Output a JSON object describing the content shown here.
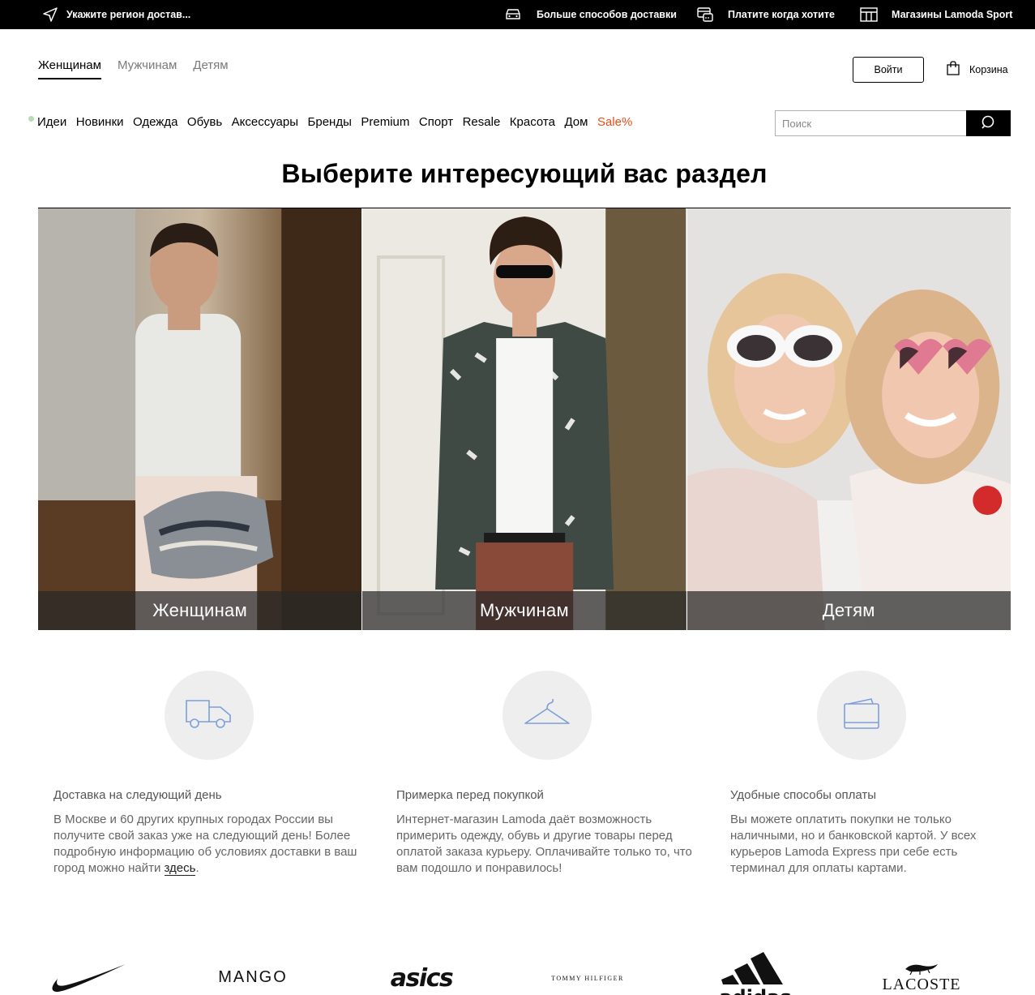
{
  "topbar": {
    "region": "Укажите регион достав...",
    "delivery": "Больше способов доставки",
    "pay": "Платите когда хотите",
    "stores": "Магазины Lamoda Sport"
  },
  "header": {
    "gender_tabs": [
      "Женщинам",
      "Мужчинам",
      "Детям"
    ],
    "active_tab": "Женщинам",
    "login": "Войти",
    "cart": "Корзина"
  },
  "catnav": {
    "items": [
      "Идеи",
      "Новинки",
      "Одежда",
      "Обувь",
      "Аксессуары",
      "Бренды",
      "Premium",
      "Спорт",
      "Resale",
      "Красота",
      "Дом"
    ],
    "sale": "Sale%"
  },
  "search": {
    "placeholder": "Поиск"
  },
  "main": {
    "title": "Выберите интересующий вас раздел",
    "sections": [
      {
        "label": "Женщинам"
      },
      {
        "label": "Мужчинам"
      },
      {
        "label": "Детям"
      }
    ]
  },
  "features": [
    {
      "icon": "delivery-truck-icon",
      "title": "Доставка на следующий день",
      "text": "В Москве и 60 других крупных городах России вы получите свой заказ уже на следующий день! Более подробную информацию об условиях доставки в ваш город можно найти ",
      "link": "здесь",
      "tail": "."
    },
    {
      "icon": "hanger-icon",
      "title": "Примерка перед покупкой",
      "text": "Интернет-магазин Lamoda даёт возможность примерить одежду, обувь и другие товары перед оплатой заказа курьеру. Оплачивайте только то, что вам подошло и понравилось!"
    },
    {
      "icon": "wallet-icon",
      "title": "Удобные способы оплаты",
      "text": "Вы можете оплатить покупки не только наличными, но и банковской картой. У всех курьеров Lamoda Express при себе есть терминал для оплаты картами."
    }
  ],
  "brands": [
    "Nike",
    "MANGO",
    "asics",
    "TOMMY HILFIGER",
    "adidas",
    "LACOSTE"
  ],
  "colors": {
    "sale": "#f04b14",
    "accent_icon": "#7d9fd9",
    "topbar_bg": "#000000"
  }
}
